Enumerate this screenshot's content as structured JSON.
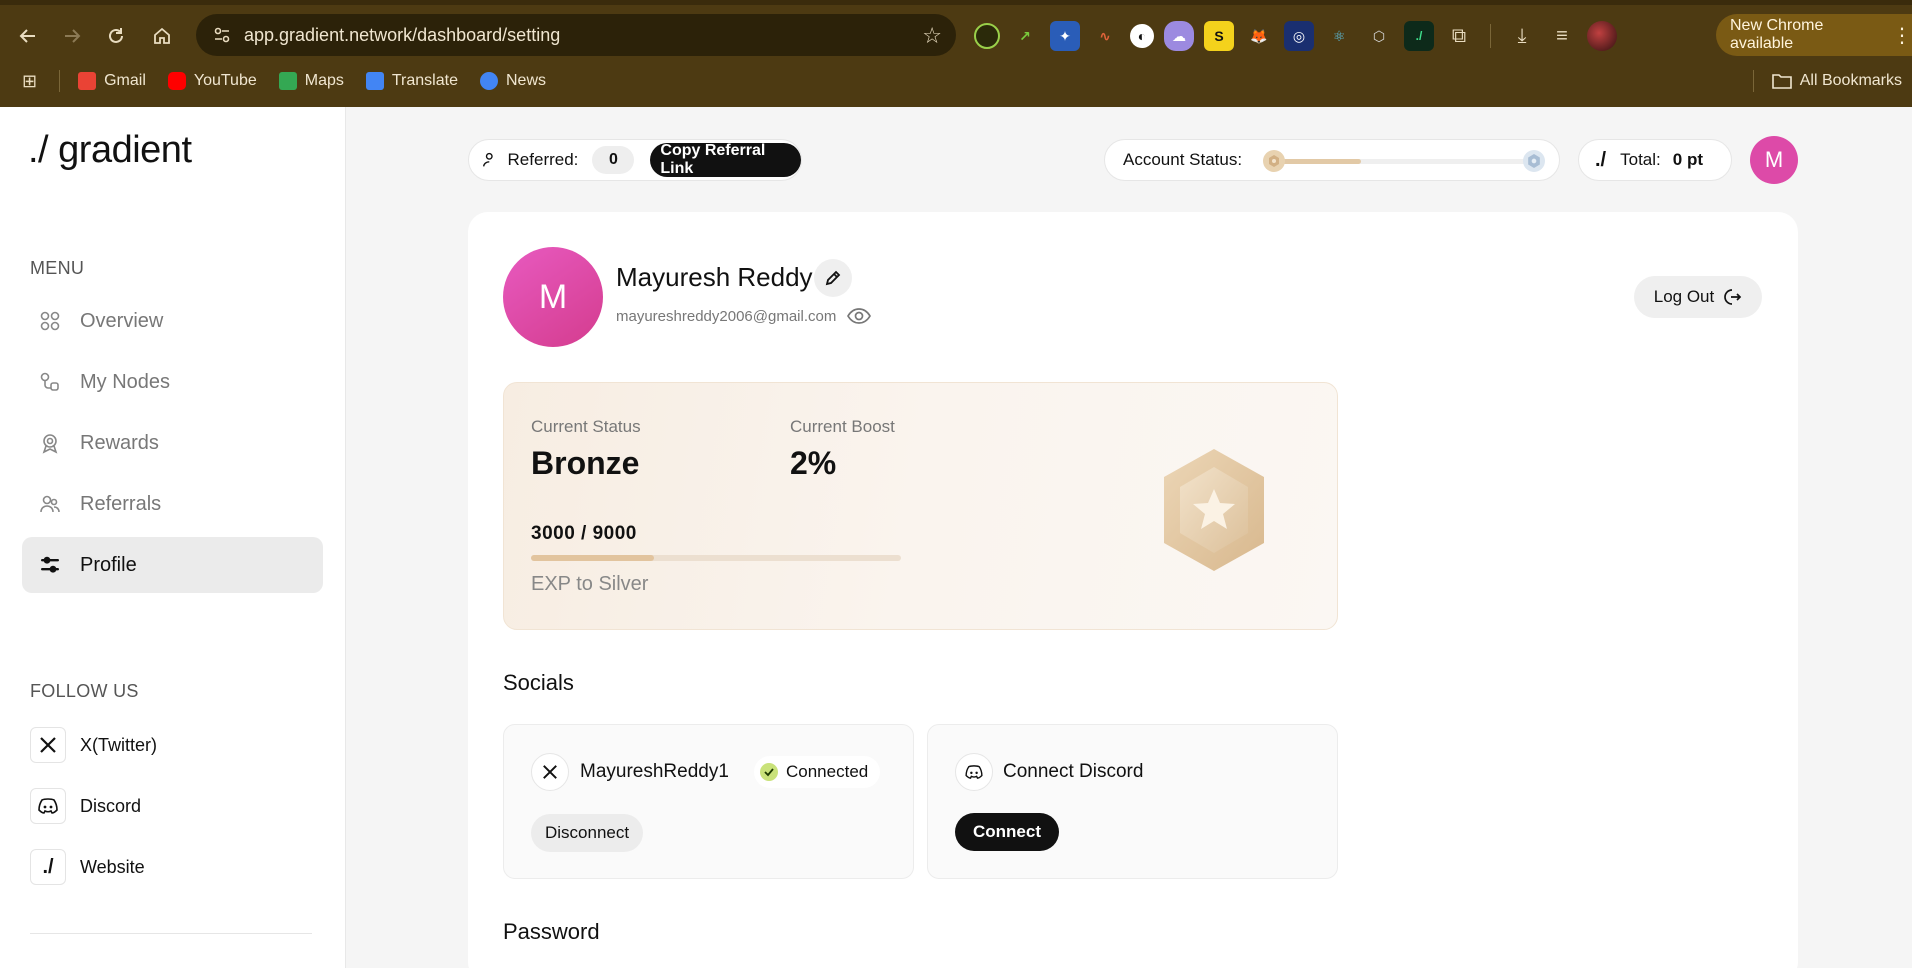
{
  "browser": {
    "url": "app.gradient.network/dashboard/setting",
    "new_chrome": "New Chrome available",
    "bookmarks": [
      {
        "label": "Gmail",
        "icon": "gmail-icon",
        "color": "#ea4335"
      },
      {
        "label": "YouTube",
        "icon": "youtube-icon",
        "color": "#ff0000"
      },
      {
        "label": "Maps",
        "icon": "maps-icon",
        "color": "#34a853"
      },
      {
        "label": "Translate",
        "icon": "translate-icon",
        "color": "#4285f4"
      },
      {
        "label": "News",
        "icon": "news-icon",
        "color": "#4285f4"
      }
    ],
    "all_bookmarks": "All Bookmarks"
  },
  "sidebar": {
    "logo": "./ gradient",
    "menu_title": "MENU",
    "menu": [
      {
        "label": "Overview",
        "icon": "grid-icon"
      },
      {
        "label": "My Nodes",
        "icon": "nodes-icon"
      },
      {
        "label": "Rewards",
        "icon": "award-icon"
      },
      {
        "label": "Referrals",
        "icon": "users-icon"
      },
      {
        "label": "Profile",
        "icon": "profile-sliders-icon",
        "active": true
      }
    ],
    "follow_title": "FOLLOW US",
    "follow": [
      {
        "label": "X(Twitter)",
        "icon": "x-icon",
        "glyph": "𝕏"
      },
      {
        "label": "Discord",
        "icon": "discord-icon",
        "glyph": ""
      },
      {
        "label": "Website",
        "icon": "gradient-logo-icon",
        "glyph": "./"
      }
    ]
  },
  "topbar": {
    "referred_label": "Referred:",
    "referred_count": "0",
    "copy_referral": "Copy Referral Link",
    "account_status_label": "Account Status:",
    "account_status_progress": 0.3333,
    "total_logo": "./",
    "total_label": "Total:",
    "total_value": "0 pt",
    "avatar_letter": "M"
  },
  "profile": {
    "avatar_letter": "M",
    "name": "Mayuresh Reddy",
    "email": "mayureshreddy2006@gmail.com",
    "logout": "Log Out"
  },
  "status": {
    "current_status_label": "Current Status",
    "current_status": "Bronze",
    "current_boost_label": "Current Boost",
    "current_boost": "2%",
    "exp_text": "3000 / 9000",
    "exp_progress": 0.3333,
    "exp_caption": "EXP to Silver"
  },
  "socials": {
    "title": "Socials",
    "twitter_handle": "MayureshReddy1",
    "twitter_status": "Connected",
    "disconnect": "Disconnect",
    "discord_label": "Connect Discord",
    "connect": "Connect"
  },
  "password": {
    "title": "Password"
  },
  "colors": {
    "chrome_bg": "#4d3a12",
    "avatar_pink": "#dd4aa8",
    "bronze": "#e2c49e"
  }
}
